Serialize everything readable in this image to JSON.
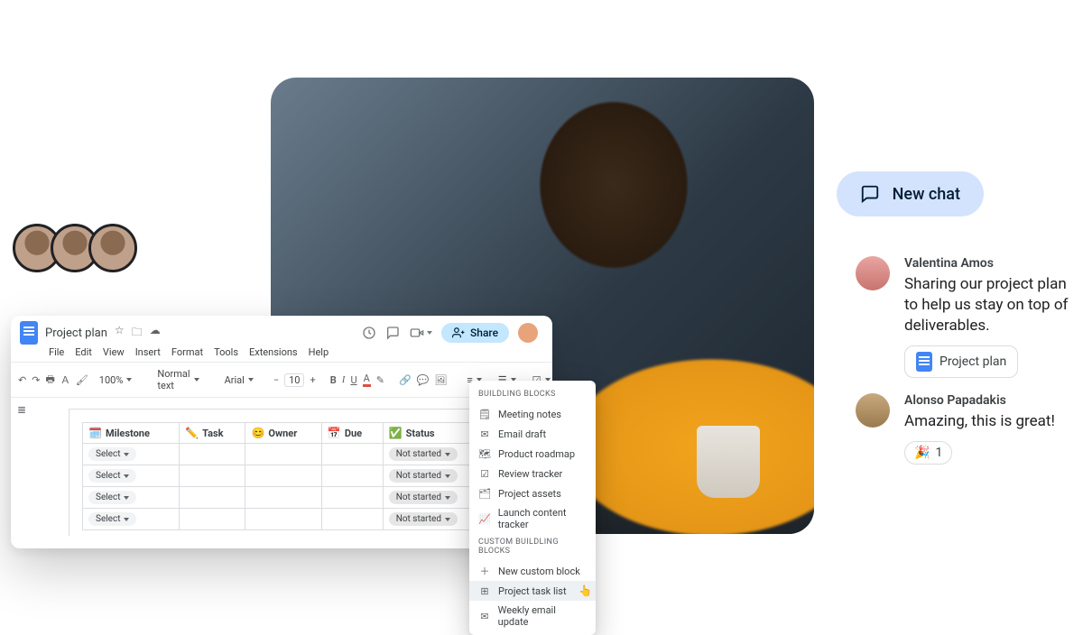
{
  "doc": {
    "title": "Project plan",
    "menus": [
      "File",
      "Edit",
      "View",
      "Insert",
      "Format",
      "Tools",
      "Extensions",
      "Help"
    ],
    "zoom": "100%",
    "style_select": "Normal text",
    "font_select": "Arial",
    "font_size": "10",
    "share_label": "Share",
    "table": {
      "headers": {
        "milestone": "Milestone",
        "task": "Task",
        "owner": "Owner",
        "due": "Due",
        "status": "Status"
      },
      "emoji": {
        "milestone": "🗓️",
        "task": "✏️",
        "owner": "😊",
        "due": "📅",
        "status": "✅"
      },
      "select_label": "Select",
      "status_label": "Not started",
      "row_count": 4
    }
  },
  "blocks_menu": {
    "section1": "BUILDLING BLOCKS",
    "section2": "CUSTOM BUILDLING BLOCKS",
    "items1": [
      "Meeting notes",
      "Email draft",
      "Product roadmap",
      "Review tracker",
      "Project assets",
      "Launch content tracker"
    ],
    "items2": [
      "New custom block",
      "Project task list",
      "Weekly email update"
    ],
    "highlighted_index": 1
  },
  "chat": {
    "new_chat": "New chat",
    "messages": [
      {
        "name": "Valentina Amos",
        "text": "Sharing our project plan to help us stay on top of deliverables.",
        "attachment_label": "Project plan"
      },
      {
        "name": "Alonso Papadakis",
        "text": "Amazing, this is great!",
        "reaction_emoji": "🎉",
        "reaction_count": "1"
      }
    ]
  }
}
